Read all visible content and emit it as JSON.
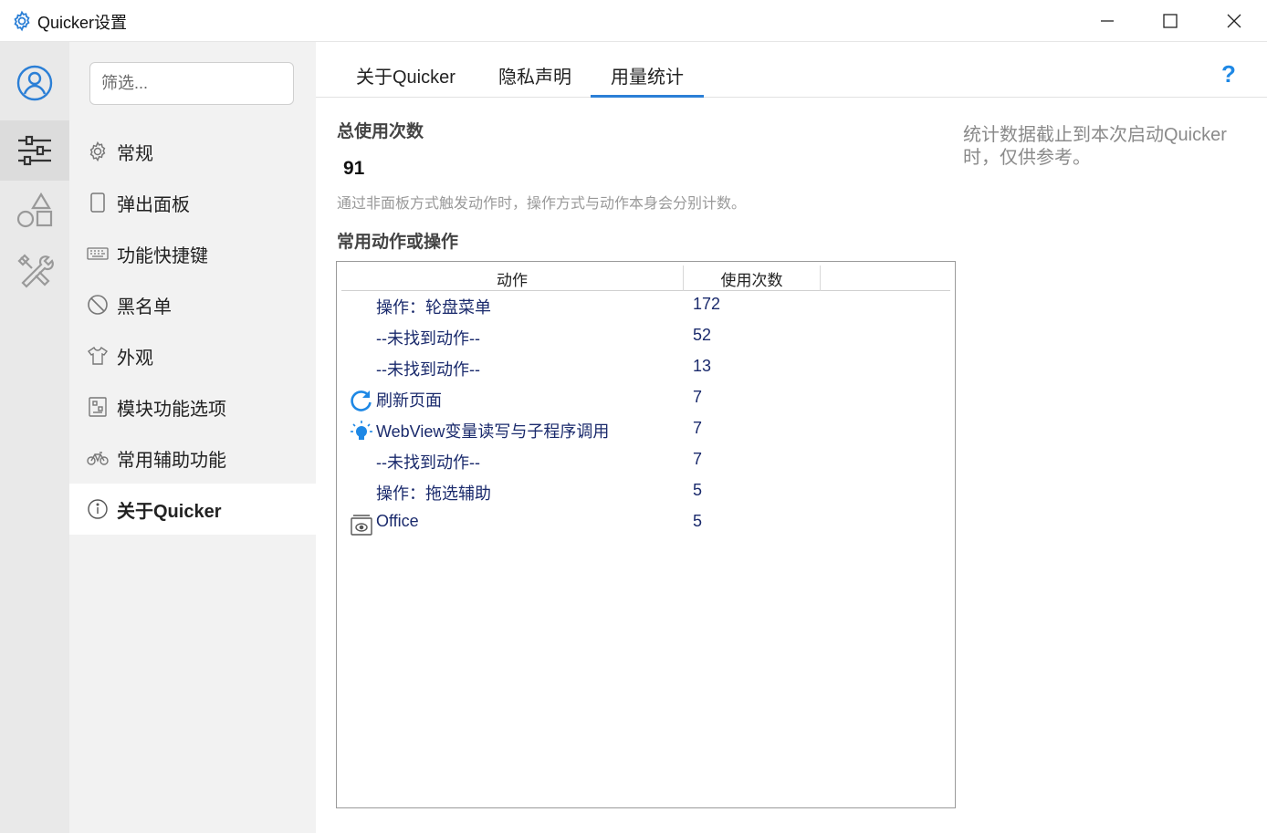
{
  "window": {
    "title": "Quicker设置"
  },
  "sidebar": {
    "filter_placeholder": "筛选...",
    "items": [
      {
        "label": "常规",
        "icon": "gear-icon"
      },
      {
        "label": "弹出面板",
        "icon": "panel-icon"
      },
      {
        "label": "功能快捷键",
        "icon": "keyboard-icon"
      },
      {
        "label": "黑名单",
        "icon": "ban-icon"
      },
      {
        "label": "外观",
        "icon": "shirt-icon"
      },
      {
        "label": "模块功能选项",
        "icon": "module-icon"
      },
      {
        "label": "常用辅助功能",
        "icon": "bicycle-icon"
      },
      {
        "label": "关于Quicker",
        "icon": "info-icon"
      }
    ]
  },
  "tabs": [
    {
      "label": "关于Quicker"
    },
    {
      "label": "隐私声明"
    },
    {
      "label": "用量统计"
    }
  ],
  "help_label": "?",
  "stats": {
    "total_heading": "总使用次数",
    "total_value": "91",
    "hint": "通过非面板方式触发动作时，操作方式与动作本身会分别计数。",
    "frequent_heading": "常用动作或操作",
    "side_note": "统计数据截止到本次启动Quicker时，仅供参考。"
  },
  "table": {
    "columns": [
      "动作",
      "使用次数"
    ],
    "rows": [
      {
        "name": "操作：轮盘菜单",
        "count": "172",
        "icon": ""
      },
      {
        "name": "--未找到动作--",
        "count": "52",
        "icon": ""
      },
      {
        "name": "--未找到动作--",
        "count": "13",
        "icon": ""
      },
      {
        "name": "刷新页面",
        "count": "7",
        "icon": "refresh-icon"
      },
      {
        "name": "WebView变量读写与子程序调用",
        "count": "7",
        "icon": "lightbulb-icon"
      },
      {
        "name": "--未找到动作--",
        "count": "7",
        "icon": ""
      },
      {
        "name": "操作：拖选辅助",
        "count": "5",
        "icon": ""
      },
      {
        "name": "Office",
        "count": "5",
        "icon": "office-icon"
      }
    ]
  },
  "colors": {
    "accent": "#2b7fd6",
    "link_text": "#1a2a6c",
    "help": "#1e88e5"
  }
}
